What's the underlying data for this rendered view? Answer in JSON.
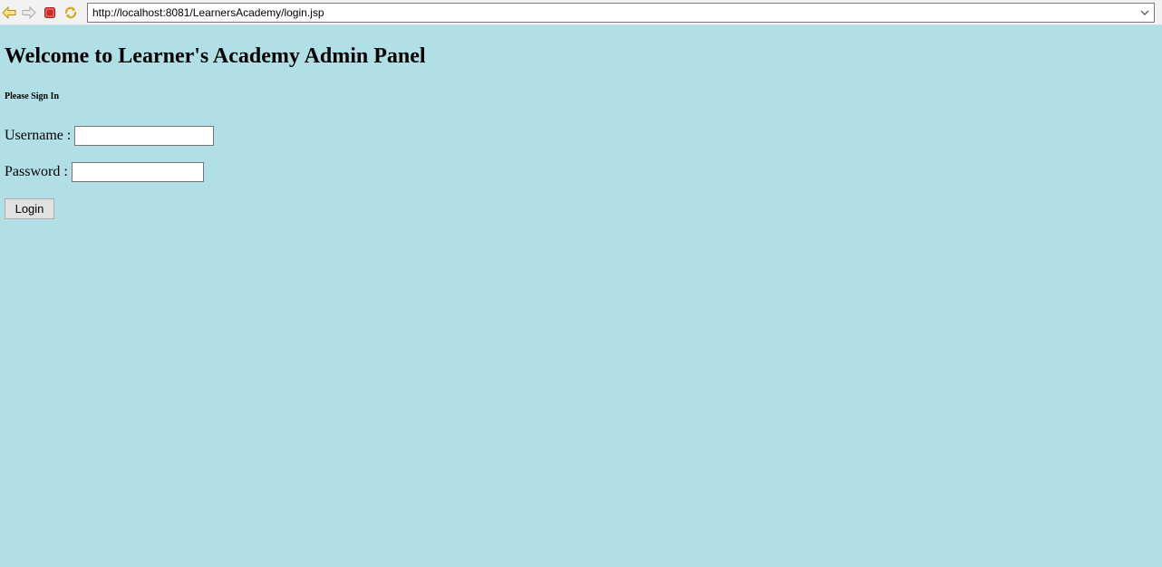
{
  "browser": {
    "url": "http://localhost:8081/LearnersAcademy/login.jsp",
    "icons": [
      "back-arrow-icon",
      "forward-arrow-icon",
      "stop-icon",
      "refresh-icon",
      "chevron-down-icon"
    ],
    "colors": {
      "back": "#e8b830",
      "forward": "#c9c9c9",
      "stop": "#d83a3a"
    }
  },
  "page": {
    "background": "#b0e0e6",
    "title": "Welcome to Learner's Academy Admin Panel",
    "subtitle": "Please Sign In",
    "form": {
      "username_label": "Username :",
      "username_value": "",
      "password_label": "Password :",
      "password_value": "",
      "login_label": "Login"
    }
  }
}
